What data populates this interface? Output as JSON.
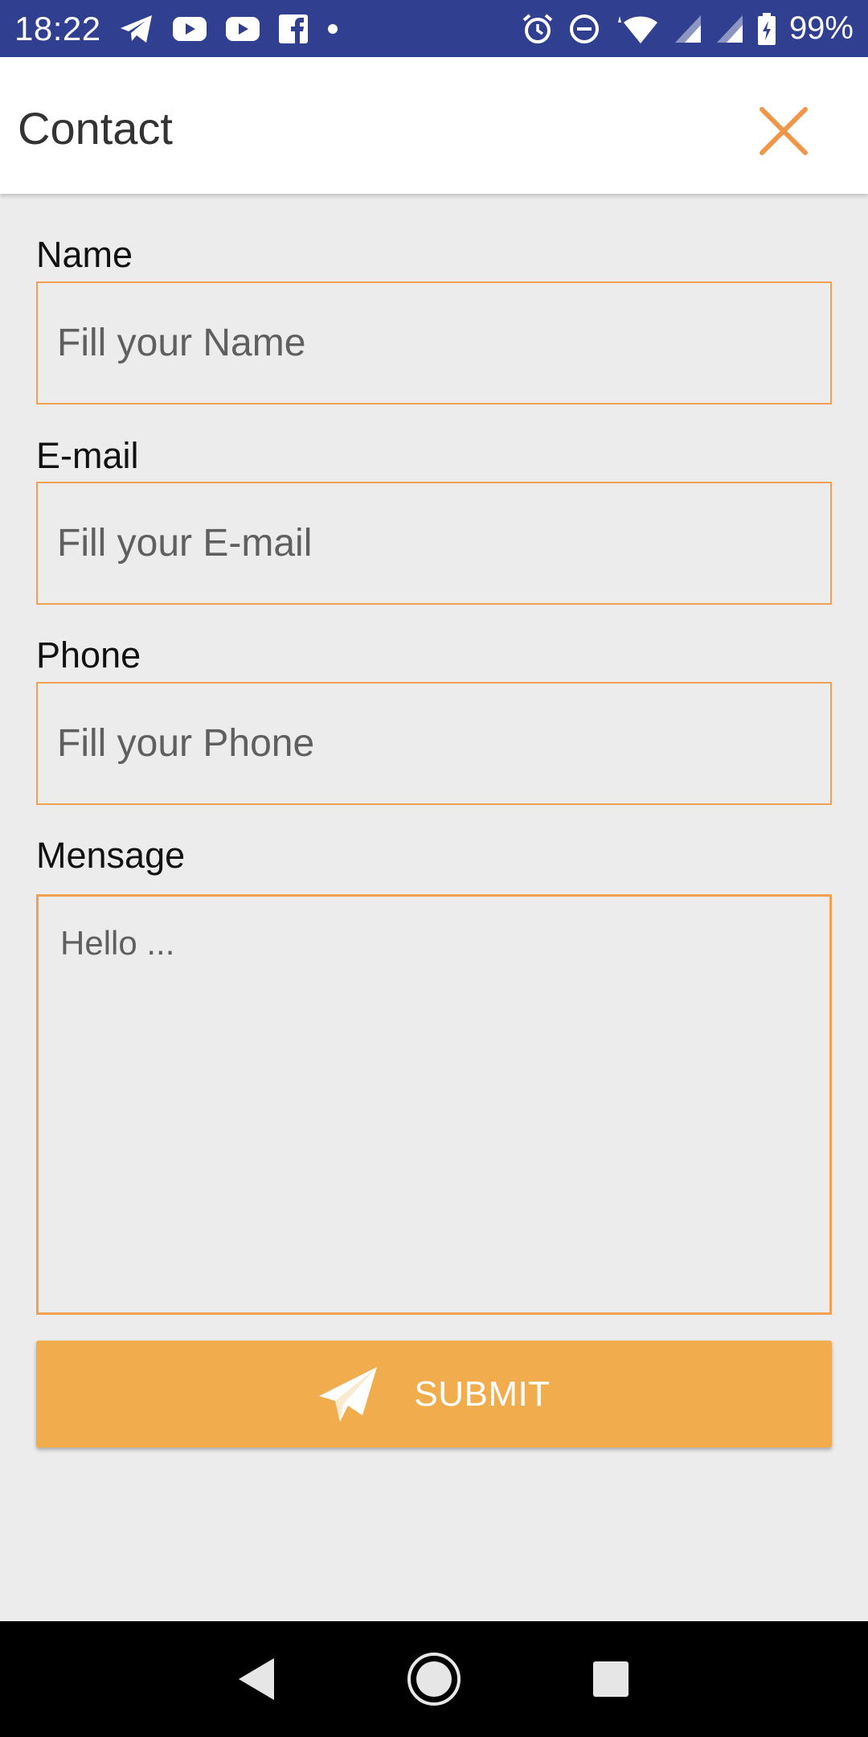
{
  "status_bar": {
    "time": "18:22",
    "battery": "99%",
    "notification_icons": [
      "telegram-icon",
      "youtube-icon",
      "youtube-icon",
      "facebook-icon",
      "dot-icon"
    ],
    "system_icons": [
      "alarm-icon",
      "do-not-disturb-icon",
      "wifi-icon",
      "signal-icon",
      "signal-icon",
      "battery-charging-icon"
    ]
  },
  "app_bar": {
    "title": "Contact",
    "close_icon": "close-icon"
  },
  "form": {
    "name": {
      "label": "Name",
      "placeholder": "Fill your Name"
    },
    "email": {
      "label": "E-mail",
      "placeholder": "Fill your E-mail"
    },
    "phone": {
      "label": "Phone",
      "placeholder": "Fill your Phone"
    },
    "message": {
      "label": "Mensage",
      "placeholder": "Hello ..."
    },
    "submit": {
      "label": "SUBMIT",
      "icon": "paper-plane-icon"
    }
  },
  "nav_bar": {
    "buttons": [
      "back-icon",
      "home-icon",
      "recents-icon"
    ]
  },
  "colors": {
    "status_bar": "#303f8f",
    "accent": "#f0a050",
    "button": "#f0ac4d",
    "background": "#ececec"
  }
}
